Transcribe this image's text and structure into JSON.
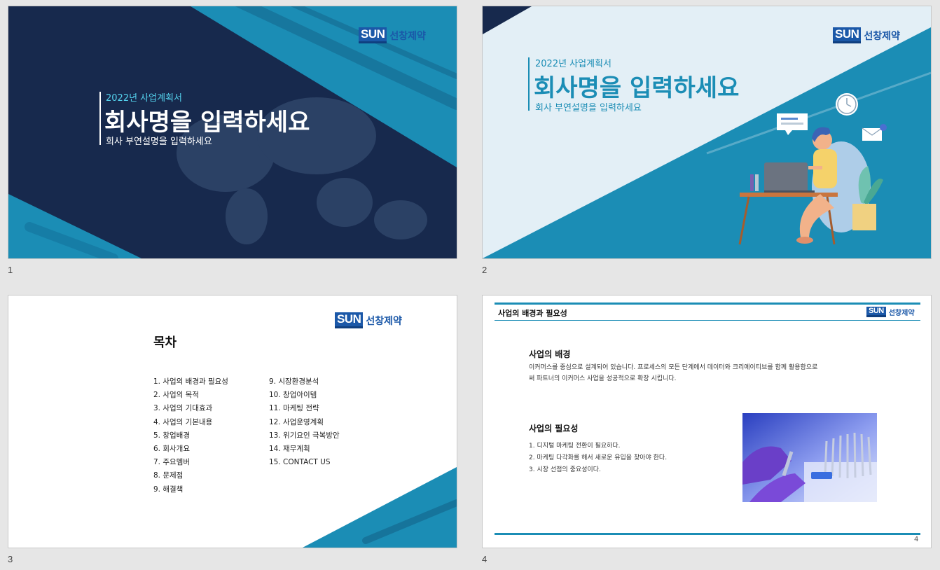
{
  "slides": [
    {
      "number": "1",
      "logo_box": "SUN",
      "logo_text": "선창제약",
      "subtitle": "2022년 사업계획서",
      "title": "회사명을 입력하세요",
      "desc": "회사 부연설명을 입력하세요"
    },
    {
      "number": "2",
      "logo_box": "SUN",
      "logo_text": "선창제약",
      "subtitle": "2022년 사업계획서",
      "title": "회사명을 입력하세요",
      "desc": "회사 부연설명을 입력하세요"
    },
    {
      "number": "3",
      "logo_box": "SUN",
      "logo_text": "선창제약",
      "heading": "목차",
      "toc_left": [
        "1.  사업의 배경과 필요성",
        "2.  사업의 목적",
        "3.  사업의 기대효과",
        "4.  사업의 기본내용",
        "5.  창업배경",
        "6.  회사개요",
        "7.  주요멤버",
        "8.  문제점",
        "9.  해결책"
      ],
      "toc_right": [
        "9.  시장환경분석",
        "10.  창업아이템",
        "11.  마케팅 전략",
        "12.  사업운영계획",
        "13.  위기요인 극복방안",
        "14.  재무계획",
        "15.  CONTACT US"
      ]
    },
    {
      "number": "4",
      "logo_box": "SUN",
      "logo_text": "선창제약",
      "header": "사업의 배경과 필요성",
      "section1_title": "사업의 배경",
      "section1_body1": "이커머스를 중심으로 설계되어 있습니다. 프로세스의 모든 단계에서 데이터와 크리에이티브를 함께 활용함으로",
      "section1_body2": "써 파트너의 이커머스 사업을 성공적으로 확장 시킵니다.",
      "section2_title": "사업의 필요성",
      "needs": [
        "1.   디지털 마케팅 전환이 필요하다.",
        "2.   마케팅 다각화를 해서 새로운 유입을 찾아야 한다.",
        "3.   시장 선점의 중요성이다."
      ],
      "page_no": "4"
    }
  ],
  "colors": {
    "navy": "#17294d",
    "teal": "#1b8db5",
    "light": "#e3eff6",
    "white": "#ffffff",
    "cyan_text": "#55d4ef"
  }
}
